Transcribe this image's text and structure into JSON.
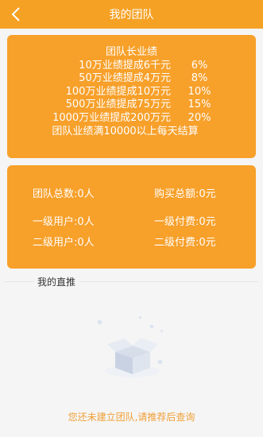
{
  "header": {
    "title": "我的团队",
    "back_icon": "chevron-left-icon"
  },
  "rules": {
    "title": "团队长业绩",
    "lines": [
      {
        "left": "10万业绩提成6千元",
        "right": "6%"
      },
      {
        "left": "50万业绩提成4万元",
        "right": "8%"
      },
      {
        "left": "100万业绩提成10万元",
        "right": "10%"
      },
      {
        "left": "500万业绩提成75万元",
        "right": "15%"
      },
      {
        "left": "1000万业绩提成200万元",
        "right": "20%"
      }
    ],
    "footer": "团队业绩满10000以上每天结算"
  },
  "stats": {
    "team_total": "团队总数:0人",
    "purchase_total": "购买总额:0元",
    "level1_users": "一级用户:0人",
    "level1_paid": "一级付费:0元",
    "level2_users": "二级用户:0人",
    "level2_paid": "二级付费:0元"
  },
  "section": {
    "title": "我的直推"
  },
  "empty": {
    "message": "您还未建立团队,请推荐后查询",
    "icon": "empty-box-icon"
  },
  "colors": {
    "accent": "#f5a124",
    "card": "#f7a02a",
    "empty_text": "#f0a036"
  }
}
